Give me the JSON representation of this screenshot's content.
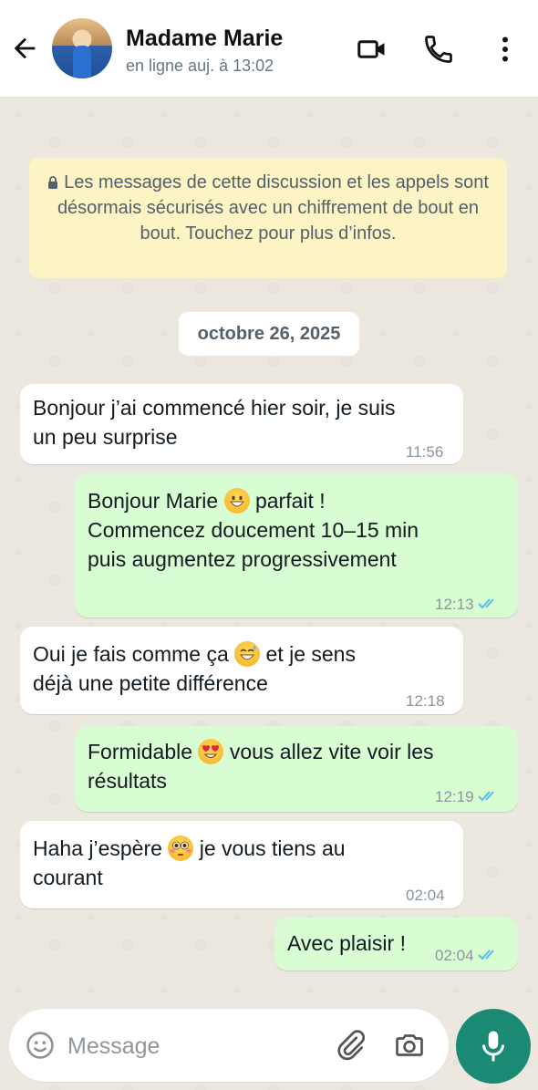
{
  "header": {
    "contact_name": "Madame Marie",
    "status": "en ligne auj. à 13:02",
    "icons": [
      "back-arrow-icon",
      "video-call-icon",
      "phone-icon",
      "more-vert-icon"
    ]
  },
  "encryption_notice": "Les messages de cette discussion et les appels sont désormais sécurisés avec un chiffrement de bout en bout. Touchez pour plus d’infos.",
  "date_chip": "octobre 26, 2025",
  "messages": [
    {
      "direction": "in",
      "line1": "Bonjour j’ai commencé hier soir, je suis",
      "line2": "un peu surprise",
      "time": "11:56"
    },
    {
      "direction": "out",
      "line1_a": "Bonjour Marie",
      "emoji": "grinning-face",
      "line1_b": "parfait !",
      "line2": "Commencez doucement 10–15 min",
      "line3": "puis augmentez progressivement",
      "time": "12:13",
      "status": "read"
    },
    {
      "direction": "in",
      "line1_a": "Oui je fais comme ça",
      "emoji": "grinning-sweat-face",
      "line1_b": "et je sens",
      "line2": "déjà une petite différence",
      "time": "12:18"
    },
    {
      "direction": "out",
      "line1_a": "Formidable",
      "emoji": "heart-eyes-face",
      "line1_b": "vous allez vite voir les",
      "line2": "résultats",
      "time": "12:19",
      "status": "read"
    },
    {
      "direction": "in",
      "line1_a": "Haha j’espère",
      "emoji": "flushed-face",
      "line1_b": "je vous tiens au",
      "line2": "courant",
      "time": "02:04"
    },
    {
      "direction": "out",
      "line1": "Avec plaisir !",
      "time": "02:04",
      "status": "read"
    }
  ],
  "composer": {
    "placeholder": "Message",
    "icons": [
      "emoji-icon",
      "attach-icon",
      "camera-icon",
      "mic-icon"
    ]
  },
  "colors": {
    "incoming_bubble": "#ffffff",
    "outgoing_bubble": "#d9fdd3",
    "notice_bg": "#fdf4c5",
    "accent_green": "#1a8a74",
    "read_ticks": "#53bdeb"
  }
}
